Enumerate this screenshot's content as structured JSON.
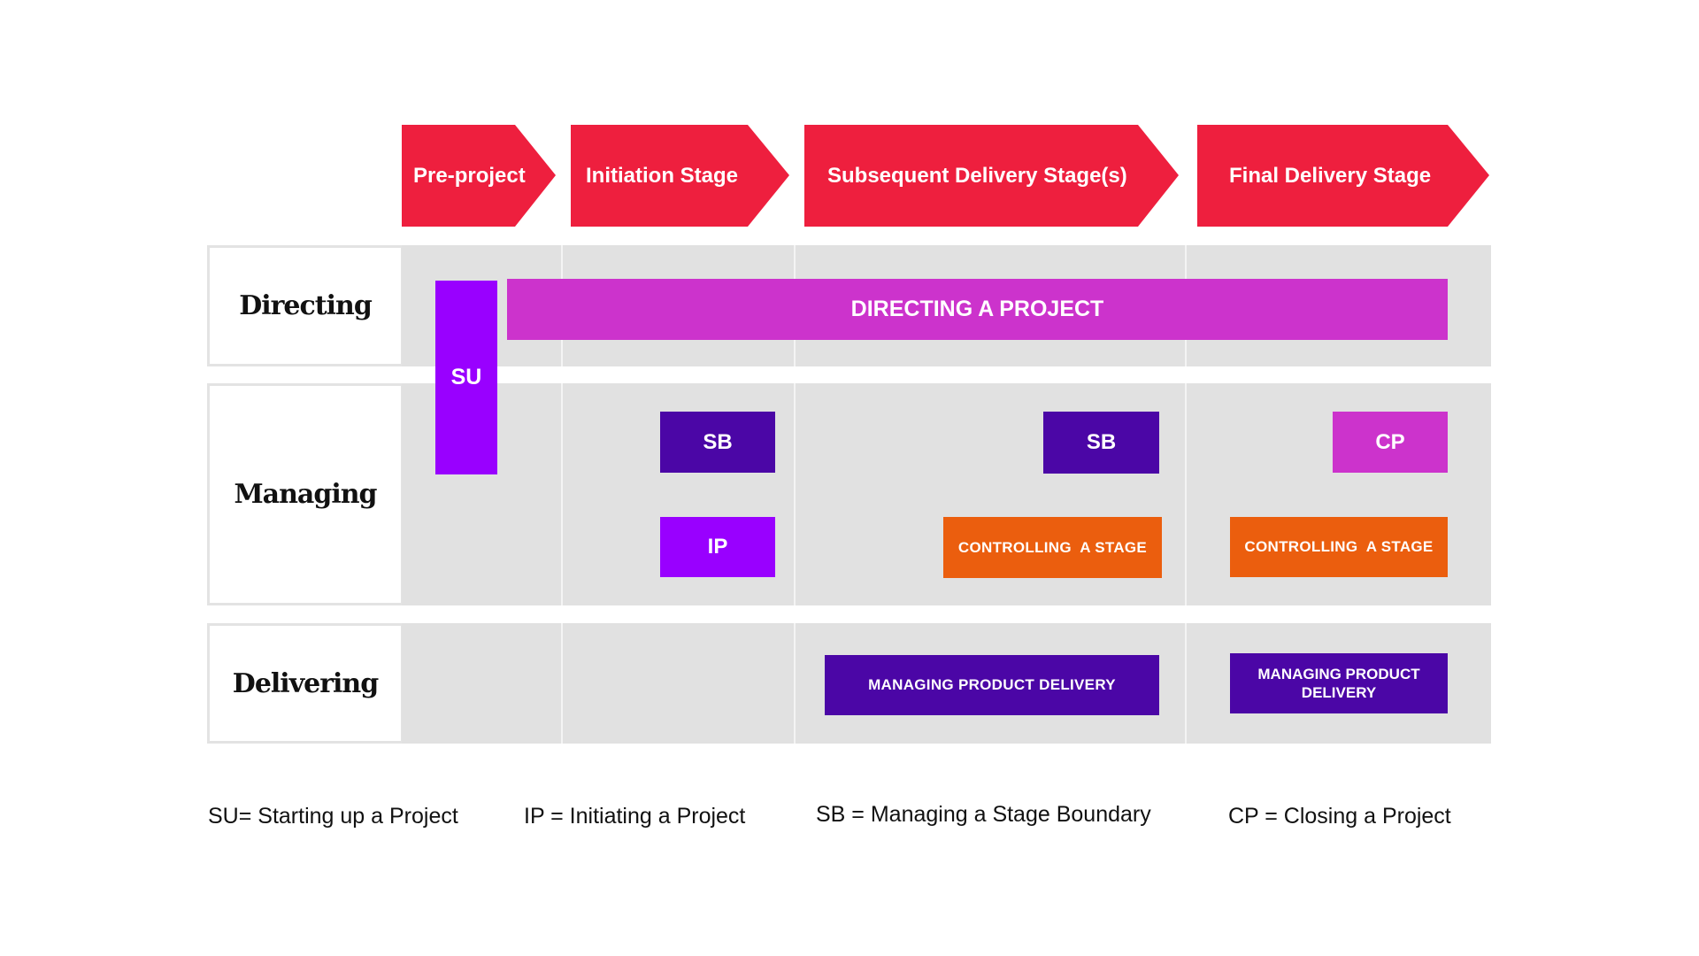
{
  "colors": {
    "stage_red": "#EE1F3E",
    "grid_grey": "#E1E1E1",
    "starting_up_violet": "#9900FF",
    "directing_magenta": "#CC33CC",
    "boundary_purple": "#4B06A6",
    "controlling_orange": "#EB5E0E"
  },
  "stages": [
    {
      "label": "Pre-project"
    },
    {
      "label": "Initiation Stage"
    },
    {
      "label": "Subsequent Delivery Stage(s)"
    },
    {
      "label": "Final Delivery Stage"
    }
  ],
  "rows": [
    {
      "label": "Directing"
    },
    {
      "label": "Managing"
    },
    {
      "label": "Delivering"
    }
  ],
  "processes": {
    "su": "SU",
    "directing_a_project": "DIRECTING A PROJECT",
    "sb_initiation": "SB",
    "ip": "IP",
    "sb_subsequent": "SB",
    "cp": "CP",
    "controlling_subsequent": "CONTROLLING  A STAGE",
    "controlling_final": "CONTROLLING  A STAGE",
    "mpd_subsequent": "MANAGING PRODUCT DELIVERY",
    "mpd_final": "MANAGING PRODUCT DELIVERY"
  },
  "legend": [
    {
      "text": "SU= Starting up a Project"
    },
    {
      "text": "IP = Initiating a Project"
    },
    {
      "text": "SB = Managing a Stage Boundary"
    },
    {
      "text": "CP = Closing a Project"
    }
  ]
}
